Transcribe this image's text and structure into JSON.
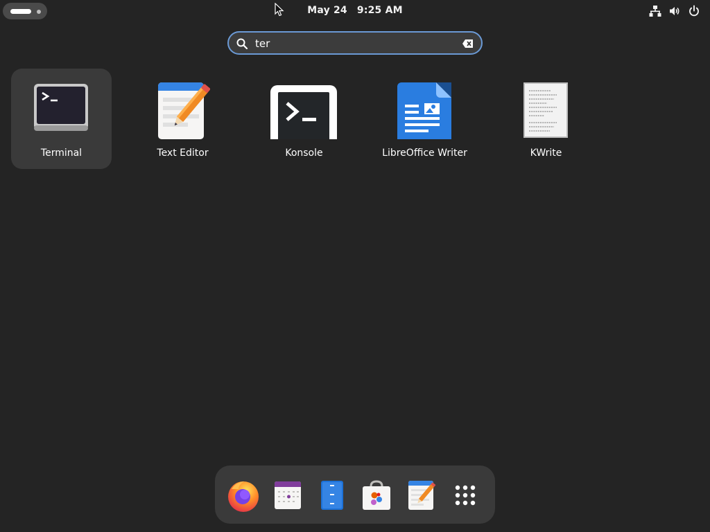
{
  "topbar": {
    "activities_label": "Activities",
    "date": "May 24",
    "time": "9:25 AM",
    "tray_icons": [
      "network-icon",
      "volume-icon",
      "power-icon"
    ]
  },
  "search": {
    "value": "ter",
    "placeholder": ""
  },
  "results": [
    {
      "label": "Terminal",
      "icon": "terminal-icon",
      "selected": true
    },
    {
      "label": "Text Editor",
      "icon": "text-editor-icon",
      "selected": false
    },
    {
      "label": "Konsole",
      "icon": "konsole-icon",
      "selected": false
    },
    {
      "label": "LibreOffice Writer",
      "icon": "libreoffice-writer-icon",
      "selected": false
    },
    {
      "label": "KWrite",
      "icon": "kwrite-icon",
      "selected": false
    }
  ],
  "dock": {
    "items": [
      "firefox-icon",
      "calendar-icon",
      "files-icon",
      "software-icon",
      "text-editor-icon",
      "show-apps-icon"
    ]
  },
  "colors": {
    "background": "#242424",
    "accent": "#6b9ad6",
    "selection": "#3a3a3a",
    "dock": "#3a3a3a"
  }
}
